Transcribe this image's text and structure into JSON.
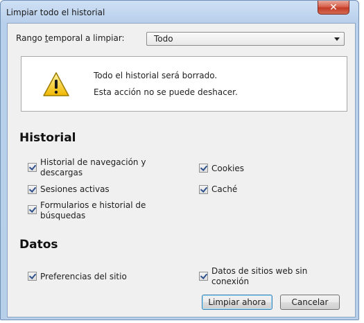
{
  "window": {
    "title": "Limpiar todo el historial",
    "close_glyph": "✕"
  },
  "range": {
    "label_prefix": "Rango ",
    "label_underlined": "t",
    "label_suffix": "emporal a limpiar:",
    "selected": "Todo"
  },
  "warning": {
    "icon": "warning-icon",
    "line1": "Todo el historial será borrado.",
    "line2": "Esta acción no se puede deshacer."
  },
  "historial": {
    "heading": "Historial",
    "items": [
      {
        "line1": "Historial de navegación y",
        "line2": "descargas",
        "checked": true
      },
      {
        "line1": "Cookies",
        "checked": true
      },
      {
        "line1": "Sesiones activas",
        "checked": true
      },
      {
        "line1": "Caché",
        "checked": true
      },
      {
        "line1": "Formularios e historial de",
        "line2": "búsquedas",
        "checked": true
      }
    ]
  },
  "datos": {
    "heading": "Datos",
    "items": [
      {
        "line1": "Preferencias del sitio",
        "checked": true
      },
      {
        "line1": "Datos de sitios web sin",
        "line2": "conexión",
        "checked": true
      }
    ]
  },
  "buttons": {
    "clear": "Limpiar ahora",
    "cancel": "Cancelar"
  }
}
